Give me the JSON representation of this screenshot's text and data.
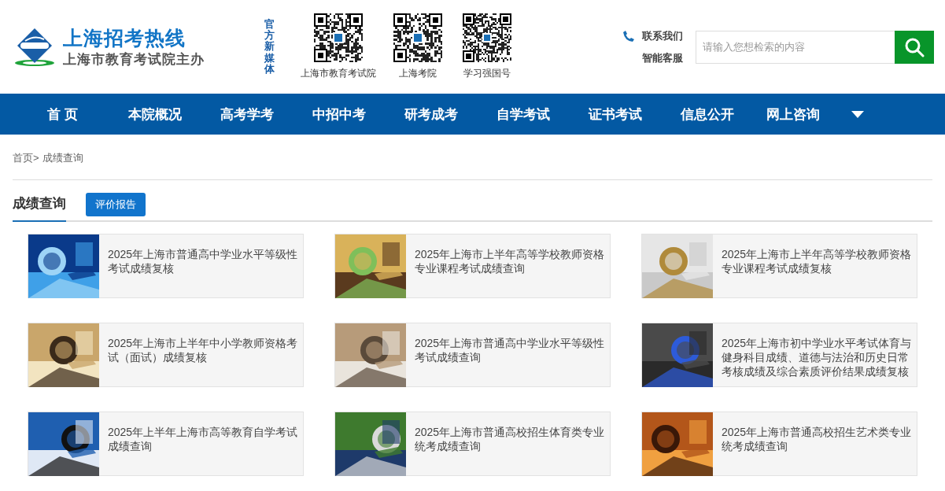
{
  "header": {
    "logo_title": "上海招考热线",
    "logo_subtitle": "上海市教育考试院主办",
    "media_label": "官方新媒体",
    "qr_codes": [
      {
        "caption": "上海市教育考试院"
      },
      {
        "caption": "上海考院"
      },
      {
        "caption": "学习强国号"
      }
    ],
    "contact": "联系我们",
    "service": "智能客服",
    "search": {
      "placeholder": "请输入您想检索的内容"
    }
  },
  "nav": {
    "items": [
      {
        "label": "首 页"
      },
      {
        "label": "本院概况"
      },
      {
        "label": "高考学考"
      },
      {
        "label": "中招中考"
      },
      {
        "label": "研考成考"
      },
      {
        "label": "自学考试"
      },
      {
        "label": "证书考试"
      },
      {
        "label": "信息公开"
      },
      {
        "label": "网上咨询"
      }
    ]
  },
  "breadcrumb": [
    {
      "label": "首页>"
    },
    {
      "label": "成绩查询"
    }
  ],
  "tabs": [
    {
      "label": "成绩查询",
      "selected": true
    },
    {
      "label": "评价报告",
      "selected": false
    }
  ],
  "cards": [
    {
      "title": "2025年上海市普通高中学业水平等级性考试成绩复核"
    },
    {
      "title": "2025年上海市上半年高等学校教师资格专业课程考试成绩查询"
    },
    {
      "title": "2025年上海市上半年高等学校教师资格专业课程考试成绩复核"
    },
    {
      "title": "2025年上海市上半年中小学教师资格考试（面试）成绩复核"
    },
    {
      "title": "2025年上海市普通高中学业水平等级性考试成绩查询"
    },
    {
      "title": "2025年上海市初中学业水平考试体育与健身科目成绩、道德与法治和历史日常考核成绩及综合素质评价结果成绩复核"
    },
    {
      "title": "2025年上半年上海市高等教育自学考试成绩查询"
    },
    {
      "title": "2025年上海市普通高校招生体育类专业统考成绩查询"
    },
    {
      "title": "2025年上海市普通高校招生艺术类专业统考成绩查询"
    }
  ]
}
